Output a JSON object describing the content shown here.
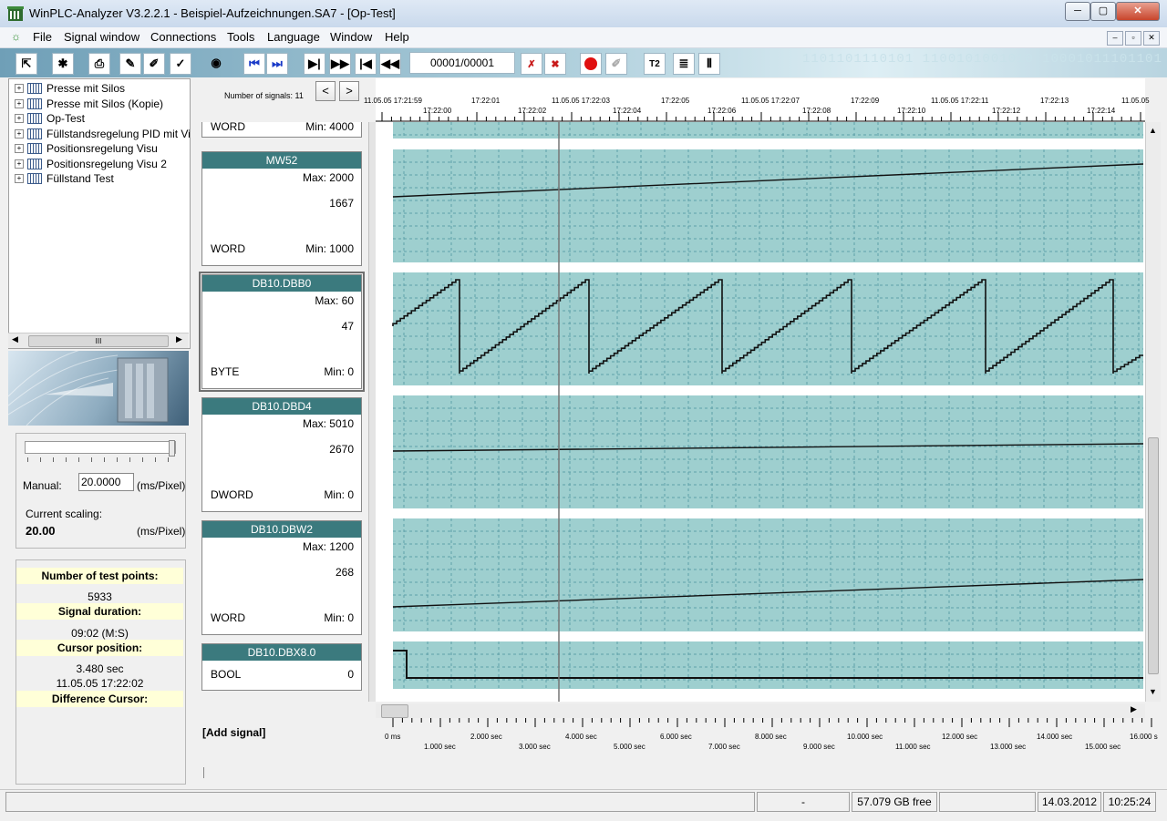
{
  "window": {
    "title": "WinPLC-Analyzer V3.2.2.1 - Beispiel-Aufzeichnungen.SA7 - [Op-Test]",
    "minimize": "─",
    "maximize": "▢",
    "close": "✕"
  },
  "menu": {
    "items": [
      "File",
      "Signal window",
      "Connections",
      "Tools",
      "Language",
      "Window",
      "Help"
    ],
    "mdi_min": "–",
    "mdi_restore": "▫",
    "mdi_close": "✕"
  },
  "toolbar": {
    "counter": "00001/00001",
    "binary_deco": "1101101110101 1100101001010 10001011101101"
  },
  "tree": {
    "items": [
      "Presse mit Silos",
      "Presse mit Silos (Kopie)",
      "Op-Test",
      "Füllstandsregelung PID mit Visu",
      "Positionsregelung Visu",
      "Positionsregelung Visu 2",
      "Füllstand Test"
    ],
    "scroll_grip": "III"
  },
  "scaling": {
    "manual_label": "Manual:",
    "manual_value": "20.0000",
    "unit": "(ms/Pixel)",
    "current_label": "Current scaling:",
    "current_value": "20.00",
    "current_unit": "(ms/Pixel)"
  },
  "info": {
    "test_points_label": "Number of test points:",
    "test_points": "5933",
    "duration_label": "Signal duration:",
    "duration": "09:02 (M:S)",
    "cursor_label": "Cursor position:",
    "cursor_sec": "3.480 sec",
    "cursor_time": "11.05.05 17:22:02",
    "diff_label": "Difference Cursor:"
  },
  "signal_header": {
    "count": "Number of signals: 11",
    "prev": "<",
    "next": ">"
  },
  "signals": [
    {
      "title": "",
      "max": "",
      "current": "",
      "type": "WORD",
      "min": "Min: 4000"
    },
    {
      "title": "MW52",
      "max": "Max: 2000",
      "current": "1667",
      "type": "WORD",
      "min": "Min: 1000"
    },
    {
      "title": "DB10.DBB0",
      "max": "Max: 60",
      "current": "47",
      "type": "BYTE",
      "min": "Min: 0"
    },
    {
      "title": "DB10.DBD4",
      "max": "Max: 5010",
      "current": "2670",
      "type": "DWORD",
      "min": "Min: 0"
    },
    {
      "title": "DB10.DBW2",
      "max": "Max: 1200",
      "current": "268",
      "type": "WORD",
      "min": "Min: 0"
    },
    {
      "title": "DB10.DBX8.0",
      "type": "BOOL",
      "current": "0"
    }
  ],
  "time_axis": {
    "upper": [
      "11.05.05 17:21:59",
      "17:22:01",
      "11.05.05 17:22:03",
      "17:22:05",
      "11.05.05 17:22:07",
      "17:22:09",
      "11.05.05 17:22:11",
      "17:22:13",
      "11.05.05"
    ],
    "lower": [
      "17:22:00",
      "17:22:02",
      "17:22:04",
      "17:22:06",
      "17:22:08",
      "17:22:10",
      "17:22:12",
      "17:22:14"
    ]
  },
  "bottom_axis": {
    "upper": [
      "0 ms",
      "2.000 sec",
      "4.000 sec",
      "6.000 sec",
      "8.000 sec",
      "10.000 sec",
      "12.000 sec",
      "14.000 sec",
      "16.000 s"
    ],
    "lower": [
      "1.000 sec",
      "3.000 sec",
      "5.000 sec",
      "7.000 sec",
      "9.000 sec",
      "11.000 sec",
      "13.000 sec",
      "15.000 sec"
    ]
  },
  "add_signal": "[Add signal]",
  "status": {
    "dash": "-",
    "free": "57.079 GB free",
    "date": "14.03.2012",
    "time": "10:25:24"
  },
  "colors": {
    "plot_bg": "#9ecfcf",
    "grid": "#5fa0a8",
    "trace": "#111111",
    "cursor": "#777777",
    "sig_title": "#3b7a7e"
  }
}
